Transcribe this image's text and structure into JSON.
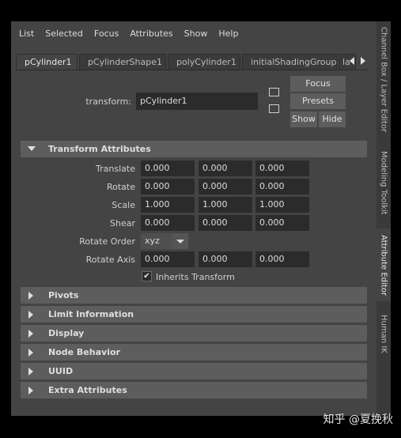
{
  "menu": [
    "List",
    "Selected",
    "Focus",
    "Attributes",
    "Show",
    "Help"
  ],
  "tabs": [
    "pCylinder1",
    "pCylinderShape1",
    "polyCylinder1",
    "initialShadingGroup",
    "la"
  ],
  "transform": {
    "label": "transform:",
    "value": "pCylinder1"
  },
  "buttons": {
    "focus": "Focus",
    "presets": "Presets",
    "show": "Show",
    "hide": "Hide"
  },
  "sections": {
    "transform_attributes": "Transform Attributes",
    "pivots": "Pivots",
    "limit_information": "Limit Information",
    "display": "Display",
    "node_behavior": "Node Behavior",
    "uuid": "UUID",
    "extra_attributes": "Extra Attributes"
  },
  "attributes": {
    "translate": {
      "label": "Translate",
      "x": "0.000",
      "y": "0.000",
      "z": "0.000"
    },
    "rotate": {
      "label": "Rotate",
      "x": "0.000",
      "y": "0.000",
      "z": "0.000"
    },
    "scale": {
      "label": "Scale",
      "x": "1.000",
      "y": "1.000",
      "z": "1.000"
    },
    "shear": {
      "label": "Shear",
      "x": "0.000",
      "y": "0.000",
      "z": "0.000"
    },
    "rotate_order": {
      "label": "Rotate Order",
      "value": "xyz"
    },
    "rotate_axis": {
      "label": "Rotate Axis",
      "x": "0.000",
      "y": "0.000",
      "z": "0.000"
    },
    "inherits_transform": {
      "label": "Inherits Transform",
      "checked": true,
      "mark": "✔"
    }
  },
  "side_tabs": [
    "Channel Box / Layer Editor",
    "Modeling Toolkit",
    "Attribute Editor",
    "Human IK"
  ],
  "watermark": "知乎 @夏挽秋"
}
